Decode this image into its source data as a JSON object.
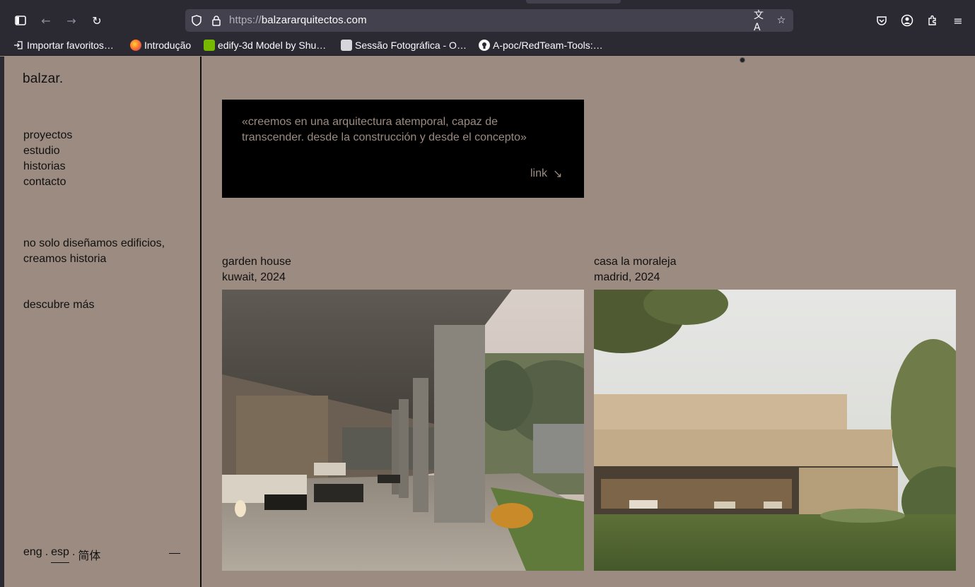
{
  "browser": {
    "url_protocol": "https://",
    "url_host": "balzararquitectos.com",
    "bookmarks": [
      {
        "label": "Importar favoritos…",
        "icon": "import-icon"
      },
      {
        "label": "Introdução",
        "icon": "firefox-icon"
      },
      {
        "label": "edify-3d Model by Shu…",
        "icon": "nvidia-icon"
      },
      {
        "label": "Sessão Fotográfica - O…",
        "icon": "page-icon"
      },
      {
        "label": "A-poc/RedTeam-Tools:…",
        "icon": "github-icon"
      }
    ]
  },
  "site": {
    "logo": "balzar.",
    "nav": [
      "proyectos",
      "estudio",
      "historias",
      "contacto"
    ],
    "tagline": "no solo diseñamos edificios, creamos historia",
    "discover": "descubre más",
    "languages": {
      "eng": "eng",
      "sep1": ".",
      "esp": "esp",
      "sep2": ".",
      "zh": "简体"
    },
    "quote": {
      "text": "«creemos en una arquitectura atemporal, capaz de transcender. desde la construcción y desde el concepto»",
      "link_label": "link",
      "link_arrow": "↘"
    },
    "projects": [
      {
        "name": "garden house",
        "place": "kuwait, 2024"
      },
      {
        "name": "casa la moraleja",
        "place": "madrid, 2024"
      }
    ]
  },
  "colors": {
    "page_bg": "#9c8b80",
    "chrome_bg": "#2b2a33",
    "quote_bg": "#000000"
  }
}
